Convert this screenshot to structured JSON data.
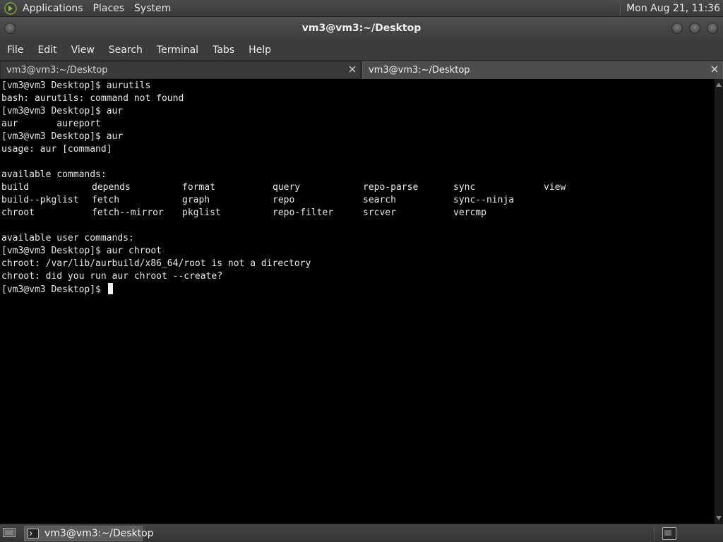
{
  "top_panel": {
    "menus": [
      "Applications",
      "Places",
      "System"
    ],
    "clock": "Mon Aug 21, 11:36",
    "logo_icon": "mate-foot-logo-icon"
  },
  "window": {
    "title": "vm3@vm3:~/Desktop"
  },
  "menubar": {
    "items": [
      "File",
      "Edit",
      "View",
      "Search",
      "Terminal",
      "Tabs",
      "Help"
    ]
  },
  "tabs": [
    {
      "label": "vm3@vm3:~/Desktop",
      "active": false
    },
    {
      "label": "vm3@vm3:~/Desktop",
      "active": true
    }
  ],
  "terminal": {
    "lines_before": [
      "[vm3@vm3 Desktop]$ aurutils",
      "bash: aurutils: command not found",
      "[vm3@vm3 Desktop]$ aur",
      "aur       aureport",
      "[vm3@vm3 Desktop]$ aur",
      "usage: aur [command]",
      "",
      "available commands:"
    ],
    "command_columns": [
      [
        "build",
        "depends",
        "format",
        "query",
        "repo-parse",
        "sync",
        "view"
      ],
      [
        "build--pkglist",
        "fetch",
        "graph",
        "repo",
        "search",
        "sync--ninja"
      ],
      [
        "chroot",
        "fetch--mirror",
        "pkglist",
        "repo-filter",
        "srcver",
        "vercmp"
      ]
    ],
    "lines_after": [
      "",
      "available user commands:",
      "[vm3@vm3 Desktop]$ aur chroot",
      "chroot: /var/lib/aurbuild/x86_64/root is not a directory",
      "chroot: did you run aur chroot --create?"
    ],
    "prompt": "[vm3@vm3 Desktop]$ "
  },
  "taskbar": {
    "task_label": "vm3@vm3:~/Desktop"
  },
  "colors": {
    "terminal_bg": "#000000",
    "terminal_fg": "#e8e8e8",
    "panel_bg": "#3a3a3a"
  }
}
